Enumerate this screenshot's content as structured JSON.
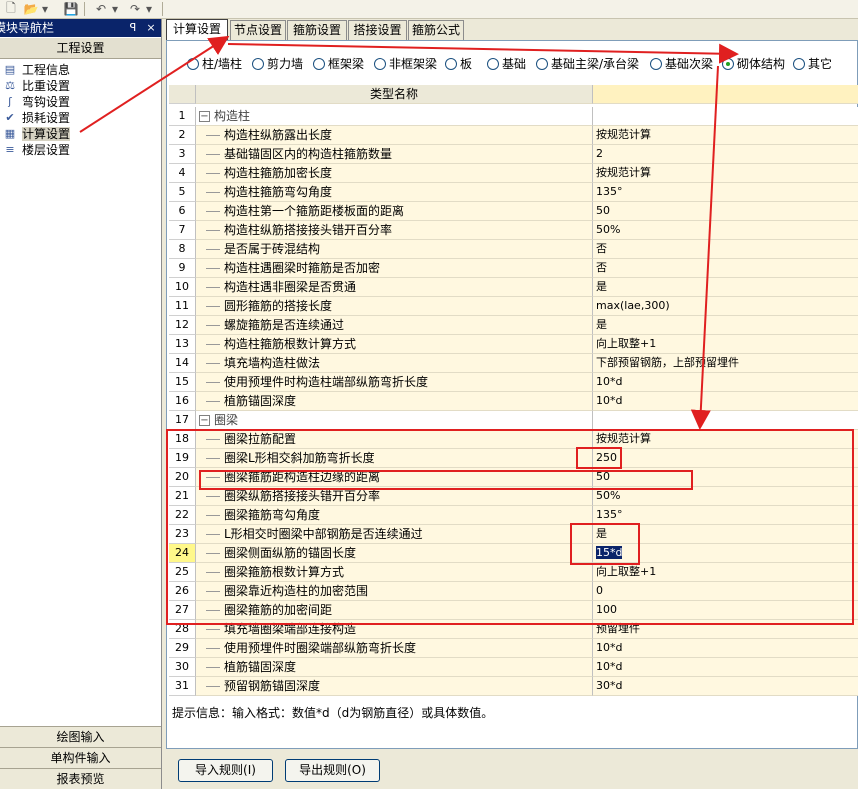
{
  "left_panel": {
    "title": "模块导航栏",
    "pin_glyph": "ꟼ",
    "close_glyph": "×",
    "group_header": "工程设置",
    "items": [
      {
        "label": "工程信息",
        "icon": "info-icon",
        "selected": false
      },
      {
        "label": "比重设置",
        "icon": "weight-icon",
        "selected": false
      },
      {
        "label": "弯钩设置",
        "icon": "hook-icon",
        "selected": false
      },
      {
        "label": "损耗设置",
        "icon": "loss-icon",
        "selected": false
      },
      {
        "label": "计算设置",
        "icon": "calculate-icon",
        "selected": true
      },
      {
        "label": "楼层设置",
        "icon": "floor-icon",
        "selected": false
      }
    ],
    "bottom_buttons": [
      "绘图输入",
      "单构件输入",
      "报表预览"
    ]
  },
  "tabs": [
    {
      "label": "计算设置",
      "active": true
    },
    {
      "label": "节点设置",
      "active": false
    },
    {
      "label": "箍筋设置",
      "active": false
    },
    {
      "label": "搭接设置",
      "active": false
    },
    {
      "label": "箍筋公式",
      "active": false
    }
  ],
  "radios": [
    {
      "label": "柱/墙柱",
      "checked": false
    },
    {
      "label": "剪力墙",
      "checked": false
    },
    {
      "label": "框架梁",
      "checked": false
    },
    {
      "label": "非框架梁",
      "checked": false
    },
    {
      "label": "板",
      "checked": false
    },
    {
      "label": "基础",
      "checked": false
    },
    {
      "label": "基础主梁/承台梁",
      "checked": false
    },
    {
      "label": "基础次梁",
      "checked": false
    },
    {
      "label": "砌体结构",
      "checked": true
    },
    {
      "label": "其它",
      "checked": false
    }
  ],
  "grid": {
    "header": {
      "name": "类型名称",
      "value": ""
    },
    "rows": [
      {
        "num": "1",
        "name": "构造柱",
        "value": "",
        "group": true
      },
      {
        "num": "2",
        "name": "构造柱纵筋露出长度",
        "value": "按规范计算"
      },
      {
        "num": "3",
        "name": "基础锚固区内的构造柱箍筋数量",
        "value": "2"
      },
      {
        "num": "4",
        "name": "构造柱箍筋加密长度",
        "value": "按规范计算"
      },
      {
        "num": "5",
        "name": "构造柱箍筋弯勾角度",
        "value": "135°"
      },
      {
        "num": "6",
        "name": "构造柱第一个箍筋距楼板面的距离",
        "value": "50"
      },
      {
        "num": "7",
        "name": "构造柱纵筋搭接接头错开百分率",
        "value": "50%"
      },
      {
        "num": "8",
        "name": "是否属于砖混结构",
        "value": "否"
      },
      {
        "num": "9",
        "name": "构造柱遇圈梁时箍筋是否加密",
        "value": "否"
      },
      {
        "num": "10",
        "name": "构造柱遇非圈梁是否贯通",
        "value": "是"
      },
      {
        "num": "11",
        "name": "圆形箍筋的搭接长度",
        "value": "max(lae,300)"
      },
      {
        "num": "12",
        "name": "螺旋箍筋是否连续通过",
        "value": "是"
      },
      {
        "num": "13",
        "name": "构造柱箍筋根数计算方式",
        "value": "向上取整+1"
      },
      {
        "num": "14",
        "name": "填充墙构造柱做法",
        "value": "下部预留钢筋，上部预留埋件"
      },
      {
        "num": "15",
        "name": "使用预埋件时构造柱端部纵筋弯折长度",
        "value": "10*d"
      },
      {
        "num": "16",
        "name": "植筋锚固深度",
        "value": "10*d"
      },
      {
        "num": "17",
        "name": "圈梁",
        "value": "",
        "group": true
      },
      {
        "num": "18",
        "name": "圈梁拉筋配置",
        "value": "按规范计算"
      },
      {
        "num": "19",
        "name": "圈梁L形相交斜加筋弯折长度",
        "value": "250"
      },
      {
        "num": "20",
        "name": "圈梁箍筋距构造柱边缘的距离",
        "value": "50"
      },
      {
        "num": "21",
        "name": "圈梁纵筋搭接接头错开百分率",
        "value": "50%"
      },
      {
        "num": "22",
        "name": "圈梁箍筋弯勾角度",
        "value": "135°"
      },
      {
        "num": "23",
        "name": "L形相交时圈梁中部钢筋是否连续通过",
        "value": "是"
      },
      {
        "num": "24",
        "name": "圈梁侧面纵筋的锚固长度",
        "value": "15*d",
        "highlight": true,
        "selected_value": true
      },
      {
        "num": "25",
        "name": "圈梁箍筋根数计算方式",
        "value": "向上取整+1"
      },
      {
        "num": "26",
        "name": "圈梁靠近构造柱的加密范围",
        "value": "0"
      },
      {
        "num": "27",
        "name": "圈梁箍筋的加密间距",
        "value": "100"
      },
      {
        "num": "28",
        "name": "填充墙圈梁端部连接构造",
        "value": "预留埋件"
      },
      {
        "num": "29",
        "name": "使用预埋件时圈梁端部纵筋弯折长度",
        "value": "10*d"
      },
      {
        "num": "30",
        "name": "植筋锚固深度",
        "value": "10*d"
      },
      {
        "num": "31",
        "name": "预留钢筋锚固深度",
        "value": "30*d"
      }
    ]
  },
  "hint": "提示信息：输入格式：数值*d（d为钢筋直径）或具体数值。",
  "buttons": {
    "import": "导入规则(I)",
    "export": "导出规则(O)"
  },
  "colors": {
    "annotation": "#e02020",
    "title_bar": "#0a246a"
  }
}
